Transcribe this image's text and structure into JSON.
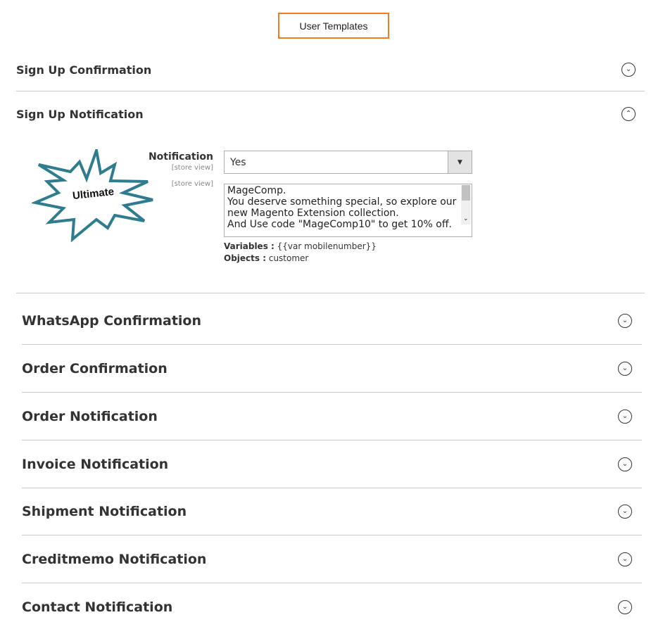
{
  "header": {
    "button_label": "User Templates",
    "accent": "#f37b20"
  },
  "sections_top": [
    {
      "title": "Sign Up Confirmation",
      "expanded": false
    },
    {
      "title": "Sign Up Notification",
      "expanded": true
    }
  ],
  "signup_notification": {
    "badge_text": "Ultimate",
    "notification_label": "Notification",
    "scope": "[store view]",
    "notification_value": "Yes",
    "message_scope": "[store view]",
    "message_lines": [
      "MageComp.",
      "You deserve something special, so explore our",
      "new Magento Extension collection.",
      "And Use code \"MageComp10\" to get 10% off."
    ],
    "variables_label": "Variables :",
    "variables_value": "{{var mobilenumber}}",
    "objects_label": "Objects :",
    "objects_value": "customer"
  },
  "sections": [
    {
      "title": "WhatsApp Confirmation"
    },
    {
      "title": "Order Confirmation"
    },
    {
      "title": "Order Notification"
    },
    {
      "title": "Invoice Notification"
    },
    {
      "title": "Shipment Notification"
    },
    {
      "title": "Creditmemo Notification"
    },
    {
      "title": "Contact Notification"
    }
  ],
  "icons": {
    "collapsed": "chevron-down-circle-icon",
    "expanded": "chevron-up-circle-icon"
  }
}
